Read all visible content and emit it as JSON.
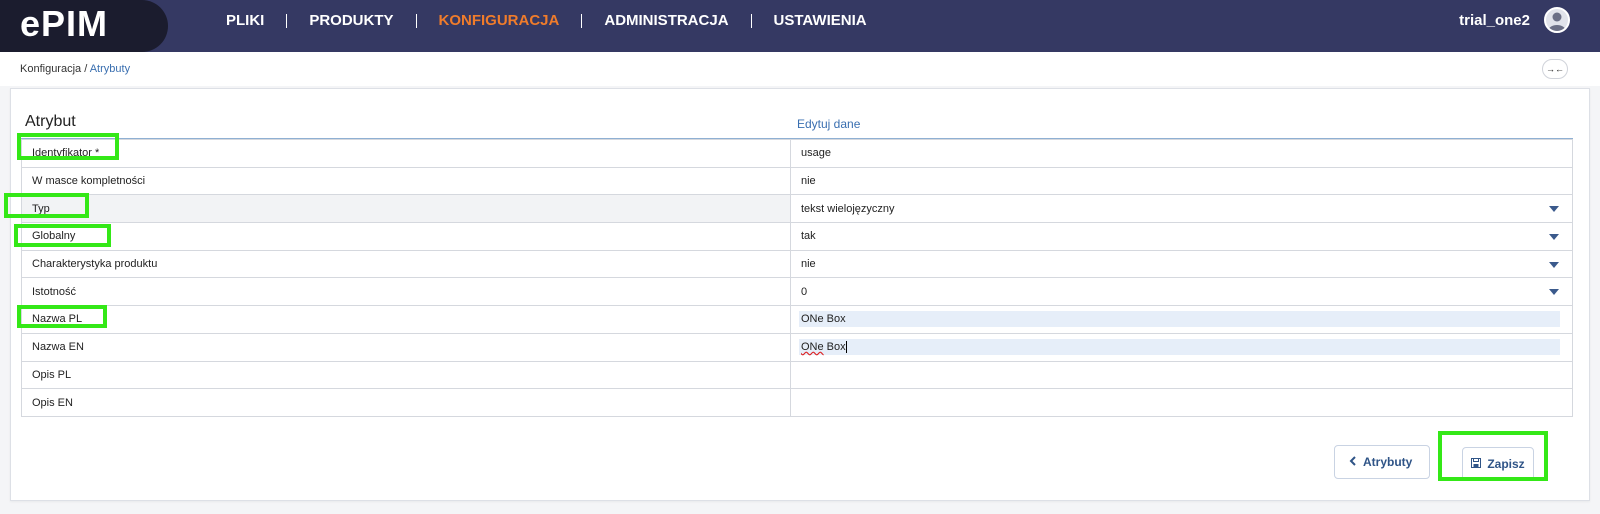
{
  "app": {
    "logo": "ePIM"
  },
  "nav": {
    "items": [
      "PLIKI",
      "PRODUKTY",
      "KONFIGURACJA",
      "ADMINISTRACJA",
      "USTAWIENIA"
    ],
    "active": "KONFIGURACJA"
  },
  "user": {
    "name": "trial_one2"
  },
  "breadcrumb": {
    "parent": "Konfiguracja",
    "separator": " / ",
    "current": "Atrybuty"
  },
  "panel": {
    "title": "Atrybut",
    "edit_label": "Edytuj dane"
  },
  "rows": [
    {
      "label": "Identyfikator *",
      "value": "usage",
      "dropdown": false
    },
    {
      "label": "W masce kompletności",
      "value": "nie",
      "dropdown": false
    },
    {
      "label": "Typ",
      "value": "tekst wielojęzyczny",
      "dropdown": true
    },
    {
      "label": "Globalny",
      "value": "tak",
      "dropdown": true
    },
    {
      "label": "Charakterystyka produktu",
      "value": "nie",
      "dropdown": true
    },
    {
      "label": "Istotność",
      "value": "0",
      "dropdown": true
    },
    {
      "label": "Nazwa PL",
      "value": "ONe Box",
      "dropdown": false
    },
    {
      "label": "Nazwa EN",
      "value_word1": "ONe",
      "value_word2": " Box",
      "dropdown": false
    },
    {
      "label": "Opis PL",
      "value": "",
      "dropdown": false
    },
    {
      "label": "Opis EN",
      "value": "",
      "dropdown": false
    }
  ],
  "buttons": {
    "back": "Atrybuty",
    "save": "Zapisz"
  },
  "colors": {
    "topbar": "#353963",
    "accent": "#f07c2b",
    "highlight": "#34e817",
    "link": "#3a6fb0"
  }
}
